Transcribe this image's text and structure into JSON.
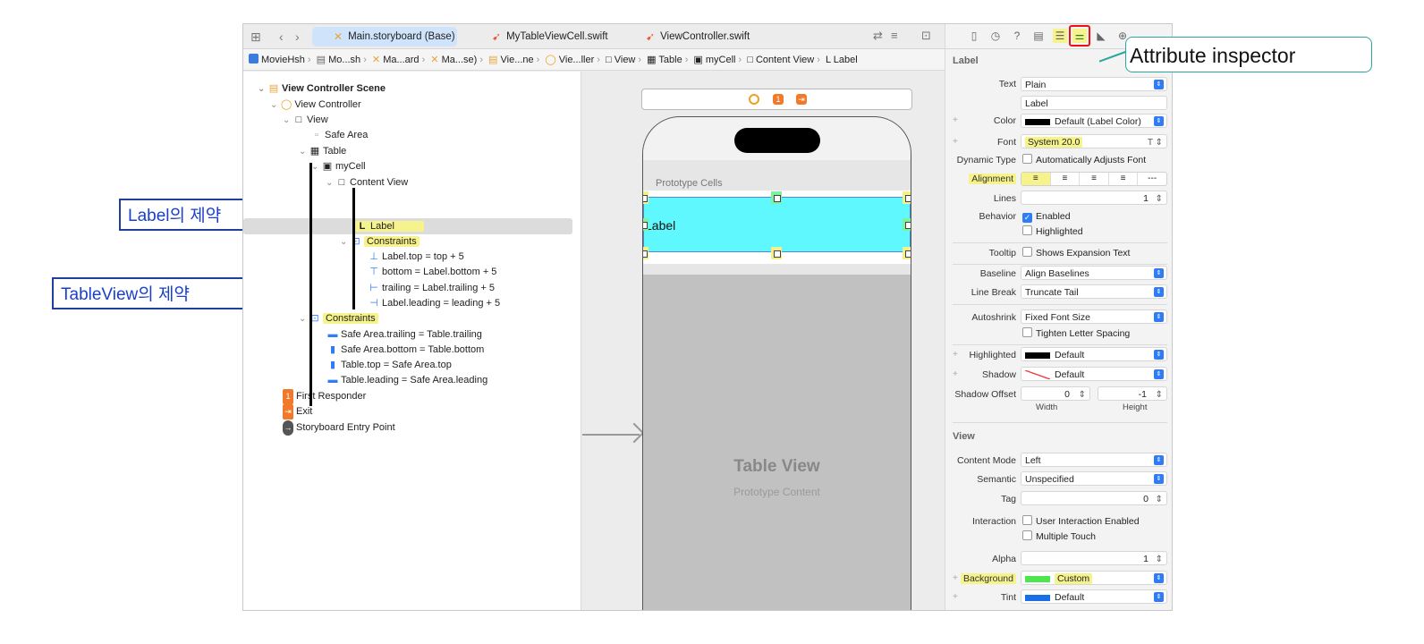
{
  "tabs": [
    {
      "label": "Main.storyboard (Base)",
      "active": true
    },
    {
      "label": "MyTableViewCell.swift",
      "active": false
    },
    {
      "label": "ViewController.swift",
      "active": false
    }
  ],
  "breadcrumb": [
    "MovieHsh",
    "Mo...sh",
    "Ma...ard",
    "Ma...se)",
    "Vie...ne",
    "Vie...ller",
    "View",
    "Table",
    "myCell",
    "Content View",
    "Label"
  ],
  "outline": {
    "scene": "View Controller Scene",
    "view_controller": "View Controller",
    "view": "View",
    "safe_area": "Safe Area",
    "table": "Table",
    "my_cell": "myCell",
    "content_view": "Content View",
    "label": "Label",
    "constraints": "Constraints",
    "cell_constraints": [
      "Label.top = top + 5",
      "bottom = Label.bottom + 5",
      "trailing = Label.trailing + 5",
      "Label.leading = leading + 5"
    ],
    "table_constraints_title": "Constraints",
    "table_constraints": [
      "Safe Area.trailing = Table.trailing",
      "Safe Area.bottom = Table.bottom",
      "Table.top = Safe Area.top",
      "Table.leading = Safe Area.leading"
    ],
    "first_responder": "First Responder",
    "exit": "Exit",
    "entry_point": "Storyboard Entry Point"
  },
  "canvas": {
    "prototype_cells": "Prototype Cells",
    "cell_label": "Label",
    "table_view_title": "Table View",
    "table_view_subtitle": "Prototype Content"
  },
  "inspector": {
    "label_section": "Label",
    "text_label": "Text",
    "text_value": "Plain",
    "text_content": "Label",
    "color_label": "Color",
    "color_value": "Default (Label Color)",
    "font_label": "Font",
    "font_value": "System 20.0",
    "dynamic_type_label": "Dynamic Type",
    "dynamic_type_value": "Automatically Adjusts Font",
    "alignment_label": "Alignment",
    "alignment_last": "---",
    "lines_label": "Lines",
    "lines_value": "1",
    "behavior_label": "Behavior",
    "enabled": "Enabled",
    "highlighted_chk": "Highlighted",
    "tooltip_label": "Tooltip",
    "tooltip_value": "Shows Expansion Text",
    "baseline_label": "Baseline",
    "baseline_value": "Align Baselines",
    "line_break_label": "Line Break",
    "line_break_value": "Truncate Tail",
    "autoshrink_label": "Autoshrink",
    "autoshrink_value": "Fixed Font Size",
    "tighten": "Tighten Letter Spacing",
    "highlighted_label": "Highlighted",
    "highlighted_value": "Default",
    "shadow_label": "Shadow",
    "shadow_value": "Default",
    "shadow_offset_label": "Shadow Offset",
    "shadow_w": "0",
    "shadow_h": "-1",
    "width_label": "Width",
    "height_label": "Height",
    "view_section": "View",
    "content_mode_label": "Content Mode",
    "content_mode_value": "Left",
    "semantic_label": "Semantic",
    "semantic_value": "Unspecified",
    "tag_label": "Tag",
    "tag_value": "0",
    "interaction_label": "Interaction",
    "user_interaction": "User Interaction Enabled",
    "multiple_touch": "Multiple Touch",
    "alpha_label": "Alpha",
    "alpha_value": "1",
    "background_label": "Background",
    "background_value": "Custom",
    "tint_label": "Tint",
    "tint_value": "Default"
  },
  "annotations": {
    "label_constraints": "Label의 제약",
    "tableview_constraints": "TableView의 제약",
    "attribute_inspector": "Attribute inspector"
  },
  "colors": {
    "highlight": "#f6f28c",
    "cell_background": "#5ff8ff",
    "accent": "#2f7cf6",
    "annotation": "#1a3fcc"
  }
}
